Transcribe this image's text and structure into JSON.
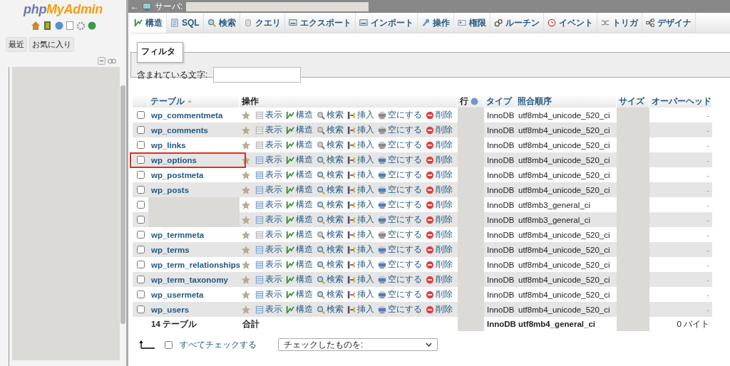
{
  "sidebar": {
    "logo": [
      "php",
      "MyAdmin"
    ],
    "buttons": [
      {
        "label": "最近"
      },
      {
        "label": "お気に入り"
      }
    ]
  },
  "topbar": {
    "back": "←",
    "server_label": "サーバ:"
  },
  "tabs": [
    {
      "label": "構造",
      "selected": true
    },
    {
      "label": "SQL",
      "selected": false
    },
    {
      "label": "検索",
      "selected": false
    },
    {
      "label": "クエリ",
      "selected": false
    },
    {
      "label": "エクスポート",
      "selected": false
    },
    {
      "label": "インポート",
      "selected": false
    },
    {
      "label": "操作",
      "selected": false
    },
    {
      "label": "権限",
      "selected": false
    },
    {
      "label": "ルーチン",
      "selected": false
    },
    {
      "label": "イベント",
      "selected": false
    },
    {
      "label": "トリガ",
      "selected": false
    },
    {
      "label": "デザイナ",
      "selected": false
    }
  ],
  "filter": {
    "legend": "フィルタ",
    "label": "含まれている文字:"
  },
  "table": {
    "columns": [
      "テーブル",
      "操作",
      "行",
      "タイプ",
      "照合順序",
      "サイズ",
      "オーバーヘッド"
    ],
    "rows": [
      {
        "kind": "table",
        "name": "wp_commentmeta",
        "checked": false,
        "empty": true,
        "highlighted": false,
        "actions": [
          "表示",
          "構造",
          "検索",
          "挿入",
          "空にする",
          "削除"
        ],
        "type": "InnoDB",
        "collation": "utf8mb4_unicode_520_ci",
        "overhead": "-"
      },
      {
        "kind": "table",
        "name": "wp_comments",
        "checked": false,
        "empty": true,
        "highlighted": false,
        "actions": [
          "表示",
          "構造",
          "検索",
          "挿入",
          "空にする",
          "削除"
        ],
        "type": "InnoDB",
        "collation": "utf8mb4_unicode_520_ci",
        "overhead": "-"
      },
      {
        "kind": "table",
        "name": "wp_links",
        "checked": false,
        "empty": true,
        "highlighted": false,
        "actions": [
          "表示",
          "構造",
          "検索",
          "挿入",
          "空にする",
          "削除"
        ],
        "type": "InnoDB",
        "collation": "utf8mb4_unicode_520_ci",
        "overhead": "-"
      },
      {
        "kind": "table",
        "name": "wp_options",
        "checked": false,
        "empty": false,
        "highlighted": true,
        "actions": [
          "表示",
          "構造",
          "検索",
          "挿入",
          "空にする",
          "削除"
        ],
        "type": "InnoDB",
        "collation": "utf8mb4_unicode_520_ci",
        "overhead": "-"
      },
      {
        "kind": "table",
        "name": "wp_postmeta",
        "checked": false,
        "empty": false,
        "highlighted": false,
        "actions": [
          "表示",
          "構造",
          "検索",
          "挿入",
          "空にする",
          "削除"
        ],
        "type": "InnoDB",
        "collation": "utf8mb4_unicode_520_ci",
        "overhead": "-"
      },
      {
        "kind": "table",
        "name": "wp_posts",
        "checked": false,
        "empty": false,
        "highlighted": false,
        "actions": [
          "表示",
          "構造",
          "検索",
          "挿入",
          "空にする",
          "削除"
        ],
        "type": "InnoDB",
        "collation": "utf8mb4_unicode_520_ci",
        "overhead": "-"
      },
      {
        "kind": "redacted",
        "checked": false,
        "empty": false,
        "highlighted": false,
        "actions": [
          "表示",
          "構造",
          "検索",
          "挿入",
          "空にする",
          "削除"
        ],
        "type": "InnoDB",
        "collation": "utf8mb3_general_ci",
        "overhead": "-"
      },
      {
        "kind": "redacted",
        "checked": false,
        "empty": false,
        "highlighted": false,
        "actions": [
          "表示",
          "構造",
          "検索",
          "挿入",
          "空にする",
          "削除"
        ],
        "type": "InnoDB",
        "collation": "utf8mb3_general_ci",
        "overhead": "-"
      },
      {
        "kind": "table",
        "name": "wp_termmeta",
        "checked": false,
        "empty": true,
        "highlighted": false,
        "actions": [
          "表示",
          "構造",
          "検索",
          "挿入",
          "空にする",
          "削除"
        ],
        "type": "InnoDB",
        "collation": "utf8mb4_unicode_520_ci",
        "overhead": "-"
      },
      {
        "kind": "table",
        "name": "wp_terms",
        "checked": false,
        "empty": false,
        "highlighted": false,
        "actions": [
          "表示",
          "構造",
          "検索",
          "挿入",
          "空にする",
          "削除"
        ],
        "type": "InnoDB",
        "collation": "utf8mb4_unicode_520_ci",
        "overhead": "-"
      },
      {
        "kind": "table",
        "name": "wp_term_relationships",
        "checked": false,
        "empty": false,
        "highlighted": false,
        "actions": [
          "表示",
          "構造",
          "検索",
          "挿入",
          "空にする",
          "削除"
        ],
        "type": "InnoDB",
        "collation": "utf8mb4_unicode_520_ci",
        "overhead": "-"
      },
      {
        "kind": "table",
        "name": "wp_term_taxonomy",
        "checked": false,
        "empty": false,
        "highlighted": false,
        "actions": [
          "表示",
          "構造",
          "検索",
          "挿入",
          "空にする",
          "削除"
        ],
        "type": "InnoDB",
        "collation": "utf8mb4_unicode_520_ci",
        "overhead": "-"
      },
      {
        "kind": "table",
        "name": "wp_usermeta",
        "checked": false,
        "empty": false,
        "highlighted": false,
        "actions": [
          "表示",
          "構造",
          "検索",
          "挿入",
          "空にする",
          "削除"
        ],
        "type": "InnoDB",
        "collation": "utf8mb4_unicode_520_ci",
        "overhead": "-"
      },
      {
        "kind": "table",
        "name": "wp_users",
        "checked": false,
        "empty": false,
        "highlighted": false,
        "actions": [
          "表示",
          "構造",
          "検索",
          "挿入",
          "空にする",
          "削除"
        ],
        "type": "InnoDB",
        "collation": "utf8mb4_unicode_520_ci",
        "overhead": "-"
      }
    ],
    "total": {
      "name": "14 テーブル",
      "label": "合計",
      "type": "InnoDB",
      "collation": "utf8mb4_general_ci",
      "overhead": "0 バイト"
    }
  },
  "footer": {
    "checked": false,
    "check_all": "すべてチェックする",
    "select_placeholder": "チェックしたものを:"
  }
}
